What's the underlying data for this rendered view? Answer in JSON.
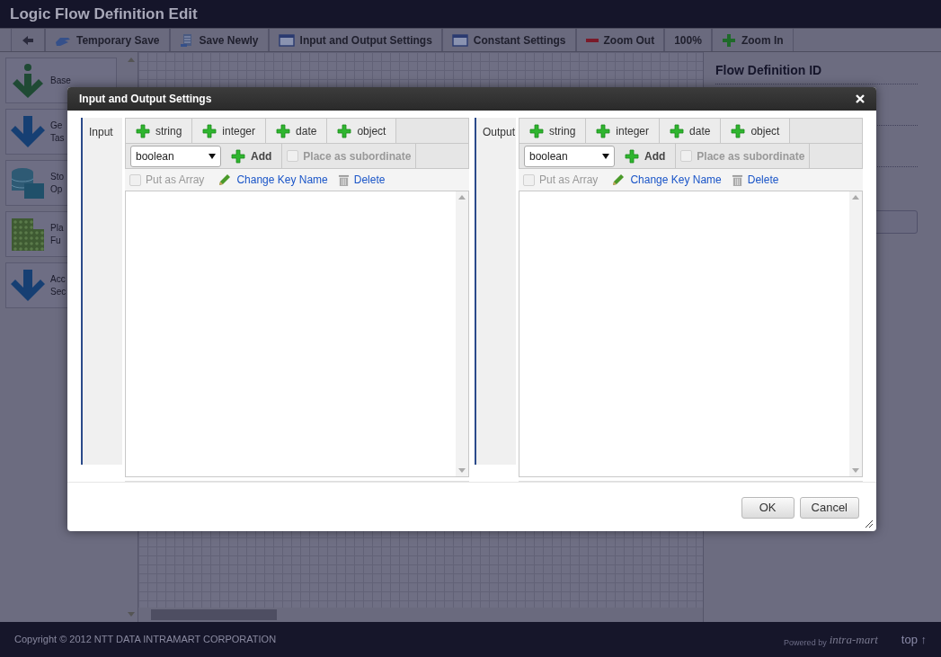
{
  "window": {
    "title": "Logic Flow Definition Edit"
  },
  "toolbar": [
    {
      "kind": "back"
    },
    {
      "kind": "save",
      "label": "Temporary Save"
    },
    {
      "kind": "save-new",
      "label": "Save Newly"
    },
    {
      "kind": "window",
      "label": "Input and Output Settings"
    },
    {
      "kind": "window",
      "label": "Constant Settings"
    },
    {
      "kind": "minus",
      "label": "Zoom Out"
    },
    {
      "kind": "text",
      "label": "100%"
    },
    {
      "kind": "plus",
      "label": "Zoom In"
    }
  ],
  "palette": [
    {
      "kind": "info",
      "lines": [
        "Base"
      ]
    },
    {
      "kind": "arrow",
      "lines": [
        "Ge",
        "Tas"
      ]
    },
    {
      "kind": "database",
      "lines": [
        "Sto",
        "Op"
      ]
    },
    {
      "kind": "grid",
      "lines": [
        "Pla",
        "Fu"
      ]
    },
    {
      "kind": "arrow",
      "lines": [
        "Acc",
        "Sec"
      ]
    }
  ],
  "properties": {
    "heading": "Flow Definition ID"
  },
  "dialog": {
    "title": "Input and Output Settings",
    "sections": [
      {
        "label": "Input",
        "type_buttons": [
          "string",
          "integer",
          "date",
          "object"
        ],
        "type_select": "boolean",
        "add_label": "Add",
        "subordinate": {
          "label": "Place as subordinate",
          "checked": false,
          "disabled": true
        },
        "array": {
          "label": "Put as Array",
          "checked": false,
          "disabled": true
        },
        "change_key": "Change Key Name",
        "delete": "Delete"
      },
      {
        "label": "Output",
        "type_buttons": [
          "string",
          "integer",
          "date",
          "object"
        ],
        "type_select": "boolean",
        "add_label": "Add",
        "subordinate": {
          "label": "Place as subordinate",
          "checked": false,
          "disabled": true
        },
        "array": {
          "label": "Put as Array",
          "checked": false,
          "disabled": true
        },
        "change_key": "Change Key Name",
        "delete": "Delete"
      }
    ],
    "buttons": [
      "OK",
      "Cancel"
    ]
  },
  "footer": {
    "copyright": "Copyright © 2012 NTT DATA INTRAMART CORPORATION",
    "powered_by": "Powered by",
    "logo": "intra-mart",
    "top_link": "top ↑"
  }
}
